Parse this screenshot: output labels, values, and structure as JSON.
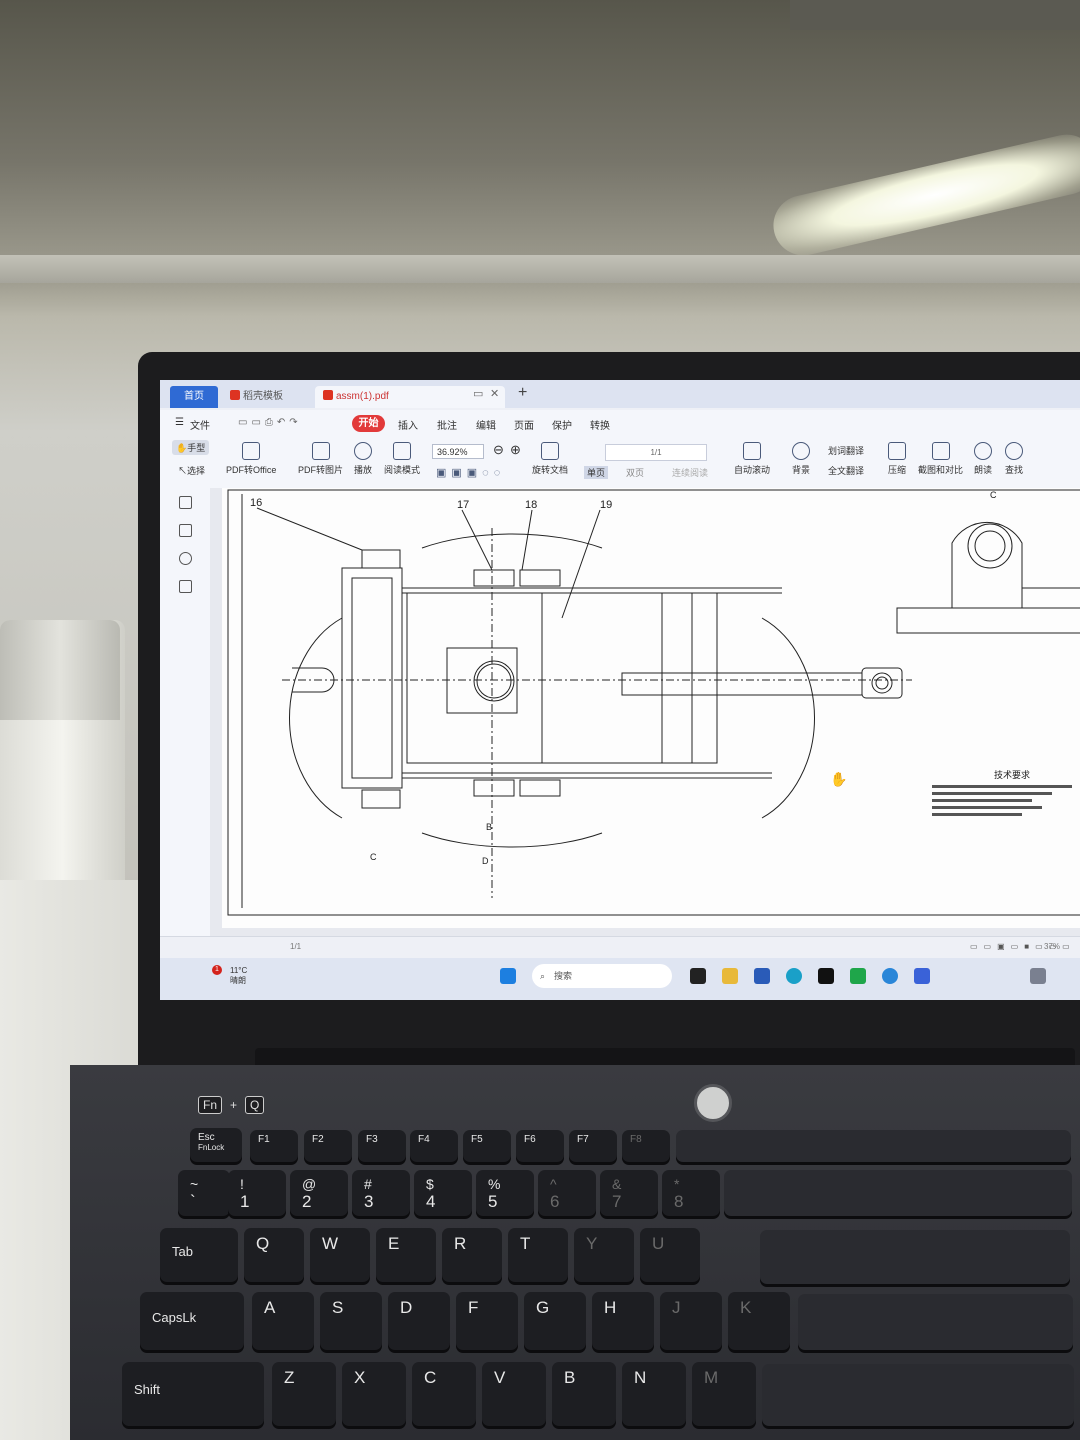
{
  "app": {
    "tabs": [
      {
        "label": "首页"
      },
      {
        "label": "稻壳模板"
      },
      {
        "label": "assm(1).pdf"
      }
    ],
    "new_tab": "+",
    "menu": {
      "file": "文件",
      "items": [
        "开始",
        "插入",
        "批注",
        "编辑",
        "页面",
        "保护",
        "转换"
      ],
      "active": "开始"
    },
    "toolbar": {
      "hand": "手型",
      "select": "选择",
      "pdf_to_office": "PDF转Office",
      "pdf_to_image": "PDF转图片",
      "play": "播放",
      "read_mode": "阅读模式",
      "zoom": "36.92%",
      "rotate": "旋转文档",
      "single_page": "单页",
      "double_page": "双页",
      "continuous": "连续阅读",
      "page_indicator": "1/1",
      "auto_scroll": "自动滚动",
      "background": "背景",
      "word_translate": "划词翻译",
      "full_translate": "全文翻译",
      "compress": "压缩",
      "screenshot_compare": "截图和对比",
      "read_aloud": "朗读",
      "find": "查找"
    },
    "statusbar": {
      "page": "1/1",
      "zoom": "37%"
    }
  },
  "drawing": {
    "labels": [
      "16",
      "17",
      "18",
      "19"
    ],
    "section_labels": {
      "b": "B",
      "c": "C",
      "d": "D",
      "c_top": "C"
    },
    "tech_title": "技术要求"
  },
  "taskbar": {
    "weather_temp": "11°C",
    "weather_desc": "晴朗",
    "weather_badge": "1",
    "search_placeholder": "搜索"
  },
  "keyboard": {
    "row_fn": [
      {
        "label": "Esc",
        "sub": "FnLock"
      },
      {
        "label": "F1"
      },
      {
        "label": "F2"
      },
      {
        "label": "F3"
      },
      {
        "label": "F4"
      },
      {
        "label": "F5"
      },
      {
        "label": "F6"
      },
      {
        "label": "F7"
      },
      {
        "label": "F8"
      }
    ],
    "row_num": [
      {
        "top": "~",
        "bottom": "`"
      },
      {
        "top": "!",
        "bottom": "1"
      },
      {
        "top": "@",
        "bottom": "2"
      },
      {
        "top": "#",
        "bottom": "3"
      },
      {
        "top": "$",
        "bottom": "4"
      },
      {
        "top": "%",
        "bottom": "5"
      },
      {
        "top": "^",
        "bottom": "6"
      },
      {
        "top": "&",
        "bottom": "7"
      },
      {
        "top": "*",
        "bottom": "8"
      }
    ],
    "row_q": [
      "Tab",
      "Q",
      "W",
      "E",
      "R",
      "T",
      "Y",
      "U"
    ],
    "row_a": [
      "CapsLk",
      "A",
      "S",
      "D",
      "F",
      "G",
      "H",
      "J",
      "K"
    ],
    "row_z": [
      "Shift",
      "Z",
      "X",
      "C",
      "V",
      "B",
      "N",
      "M"
    ],
    "fn_combo": [
      "Fn",
      "+",
      "Q"
    ]
  }
}
